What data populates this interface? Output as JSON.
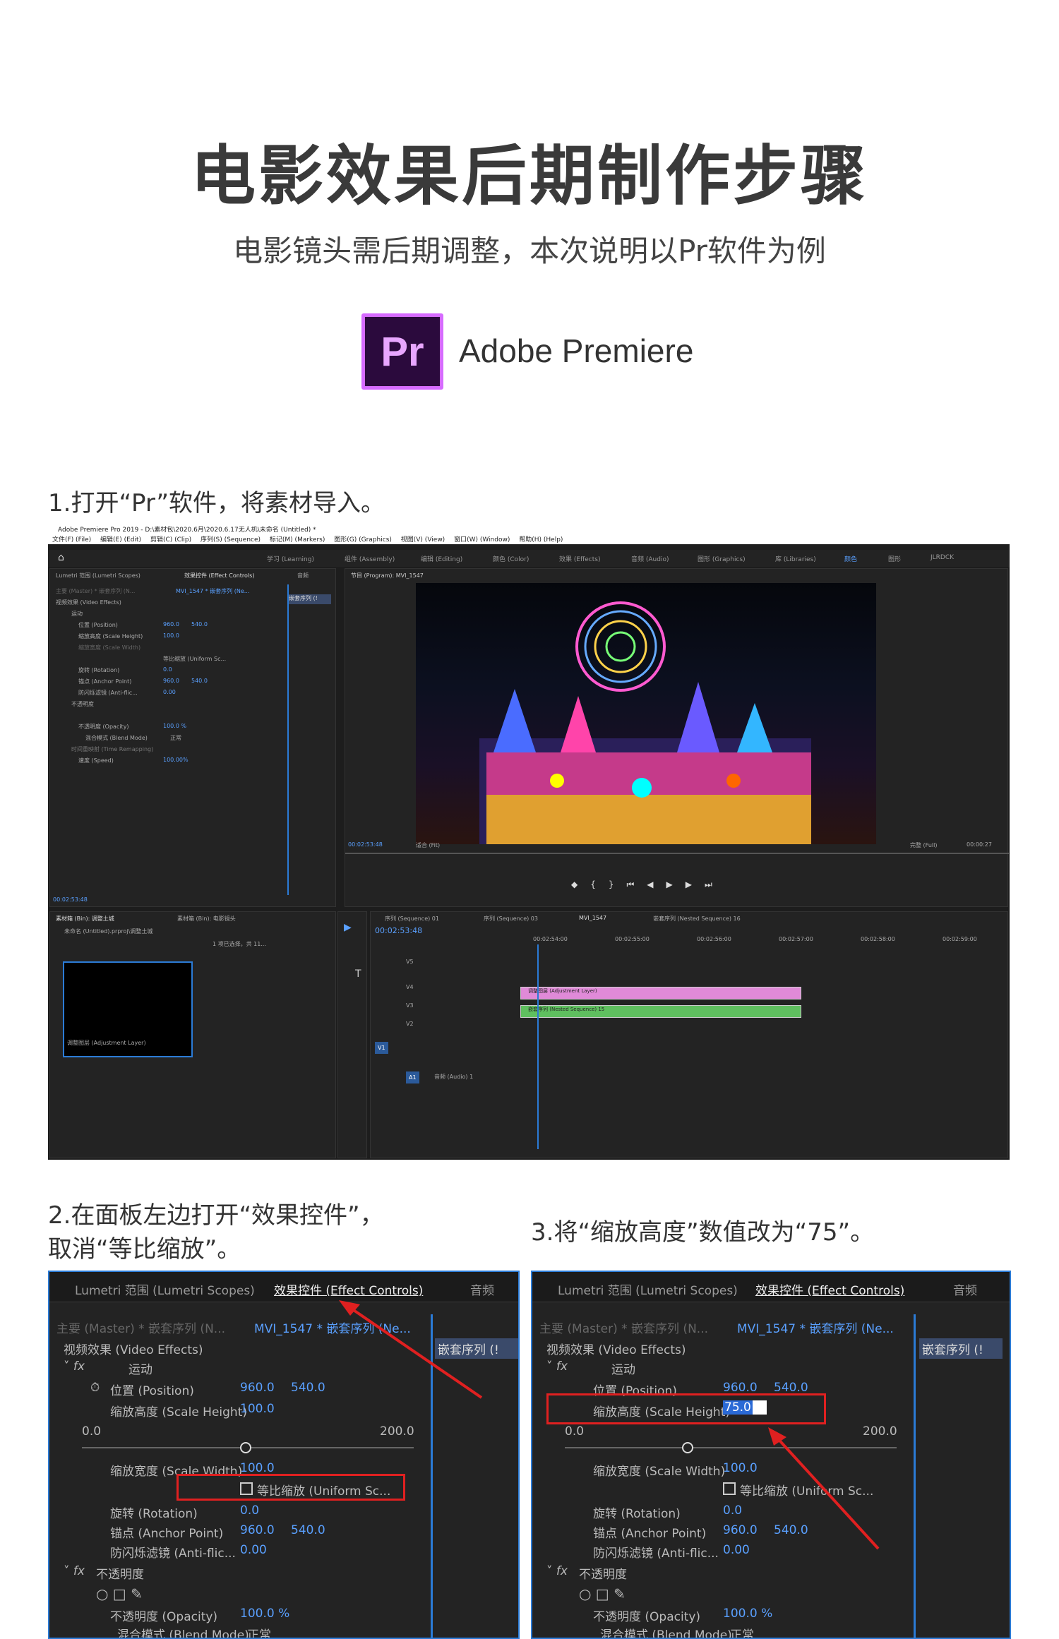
{
  "header": {
    "title": "电影效果后期制作步骤",
    "subtitle": "电影镜头需后期调整，本次说明以Pr软件为例",
    "logo_text": "Pr",
    "product_name": "Adobe Premiere"
  },
  "steps": {
    "step1": "1.打开“Pr”软件，将素材导入。",
    "step2_line1": "2.在面板左边打开“效果控件”，",
    "step2_line2": "取消“等比缩放”。",
    "step3": "3.将“缩放高度”数值改为“75”。"
  },
  "app": {
    "window_title": "Adobe Premiere Pro 2019 - D:\\素材包\\2020.6月\\2020.6.17无人机\\未命名 (Untitled) *",
    "menu": [
      "文件(F) (File)",
      "编辑(E) (Edit)",
      "剪辑(C) (Clip)",
      "序列(S) (Sequence)",
      "标记(M) (Markers)",
      "图形(G) (Graphics)",
      "视图(V) (View)",
      "窗口(W) (Window)",
      "帮助(H) (Help)"
    ],
    "workspaces": [
      "学习 (Learning)",
      "组件 (Assembly)",
      "编辑 (Editing)",
      "颜色 (Color)",
      "效果 (Effects)",
      "音频 (Audio)",
      "图形 (Graphics)",
      "库 (Libraries)",
      "颜色",
      "图形",
      "JLRDCK"
    ],
    "left_tabs": [
      "Lumetri 范围 (Lumetri Scopes)",
      "效果控件 (Effect Controls)",
      "音频"
    ],
    "program_label": "节目 (Program): MVI_1547",
    "timecode_left": "00:02:53:48",
    "fit_label": "适合 (Fit)",
    "full_label": "完整 (Full)",
    "timecode_right": "00:00:27",
    "project_tabs": [
      "素材箱 (Bin): 调整土城",
      "素材箱 (Bin): 电影镜头"
    ],
    "project_path": "未命名 (Untitled).prproj\\调整土城",
    "selected_count": "1 项已选择，共 11...",
    "thumb_label": "调整图层 (Adjustment Layer)",
    "sequence_tabs": [
      "序列 (Sequence) 01",
      "序列 (Sequence) 03",
      "MVI_1547",
      "嵌套序列 (Nested Sequence) 16"
    ],
    "seq_timecode": "00:02:53:48",
    "ruler": [
      "00:02:54:00",
      "00:02:55:00",
      "00:02:56:00",
      "00:02:57:00",
      "00:02:58:00",
      "00:02:59:00"
    ],
    "tracks": [
      "V5",
      "V4",
      "V3",
      "V2",
      "V1",
      "A1"
    ],
    "clip_adjustment": "调整图层 (Adjustment Layer)",
    "clip_nested": "嵌套序列 (Nested Sequence) 15",
    "audio_label": "音频 (Audio) 1"
  },
  "effect_controls": {
    "tab_scopes": "Lumetri 范围 (Lumetri Scopes)",
    "tab_effects": "效果控件 (Effect Controls)",
    "tab_audio": "音频",
    "master": "主要 (Master) * 嵌套序列 (N...",
    "sequence": "MVI_1547 * 嵌套序列 (Ne...",
    "nested_badge": "嵌套序列 (!",
    "video_effects": "视频效果 (Video Effects)",
    "motion": "运动",
    "position_label": "位置 (Position)",
    "position_x": "960.0",
    "position_y": "540.0",
    "scale_height_label": "缩放高度 (Scale Height)",
    "scale_height_value": "100.0",
    "scale_height_new": "75.0",
    "slider_min": "0.0",
    "slider_max": "200.0",
    "scale_width_label": "缩放宽度 (Scale Width)",
    "scale_width_value": "100.0",
    "uniform_scale": "等比缩放 (Uniform Sc...",
    "uniform_scale_short": "等比缩放 (Uniform Sc...",
    "rotation_label": "旋转 (Rotation)",
    "rotation_value": "0.0",
    "anchor_label": "锚点 (Anchor Point)",
    "anchor_x": "960.0",
    "anchor_y": "540.0",
    "antiflicker_label": "防闪烁滤镜 (Anti-flic...",
    "antiflicker_value": "0.00",
    "opacity_section": "不透明度",
    "opacity_label": "不透明度 (Opacity)",
    "opacity_value": "100.0 %",
    "blend_label": "混合模式 (Blend Mode)",
    "blend_value": "正常",
    "time_remap": "时间重映射 (Time Remapping)",
    "speed_label": "速度 (Speed)",
    "speed_value": "100.00%"
  },
  "colors": {
    "accent_blue": "#2b7bd6",
    "highlight_red": "#e02020",
    "pr_purple": "#d66bff",
    "clip_pink": "#e08ad8",
    "clip_green": "#5fbf5f"
  }
}
